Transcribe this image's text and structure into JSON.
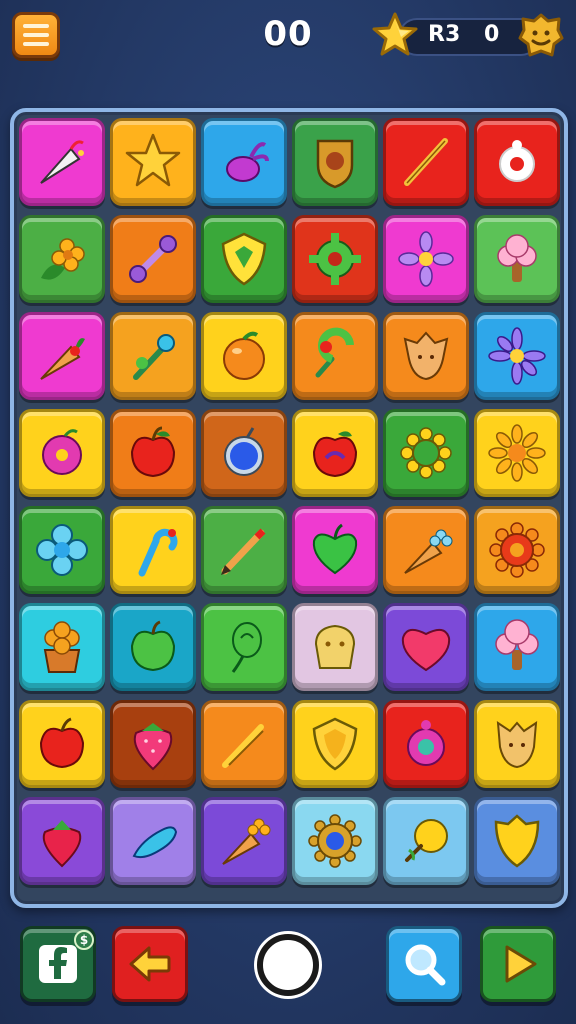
{
  "header": {
    "menu_icon": "hamburger-menu-icon",
    "score": "00",
    "star_icon": "gold-star-icon",
    "counter_label": "R3",
    "counter_value": "0",
    "badge_icon": "gold-face-badge-icon"
  },
  "board": {
    "columns": 6,
    "rows": [
      [
        {
          "name": "party-popper",
          "bg": "#ef3ad0",
          "icon": "party-popper-icon"
        },
        {
          "name": "star",
          "bg": "#ffb21c",
          "icon": "star-icon"
        },
        {
          "name": "radish",
          "bg": "#2ea7ea",
          "icon": "radish-icon"
        },
        {
          "name": "crest",
          "bg": "#3aa24a",
          "icon": "crest-icon"
        },
        {
          "name": "stick",
          "bg": "#e8231d",
          "icon": "stick-icon"
        },
        {
          "name": "ring",
          "bg": "#e8231d",
          "icon": "ring-icon"
        }
      ],
      [
        {
          "name": "flower-leaf",
          "bg": "#4caf45",
          "icon": "flower-leaf-icon"
        },
        {
          "name": "dumbbell",
          "bg": "#f07d18",
          "icon": "dumbbell-icon"
        },
        {
          "name": "shield",
          "bg": "#3aa83a",
          "icon": "shield-icon"
        },
        {
          "name": "gear",
          "bg": "#e0341b",
          "icon": "gear-icon"
        },
        {
          "name": "purple-flower",
          "bg": "#ef3ad0",
          "icon": "purple-flower-icon"
        },
        {
          "name": "mushroom-tree",
          "bg": "#5cc257",
          "icon": "mushroom-tree-icon"
        }
      ],
      [
        {
          "name": "carrot",
          "bg": "#ef3ad0",
          "icon": "carrot-icon"
        },
        {
          "name": "pinwheel",
          "bg": "#f5a21f",
          "icon": "pinwheel-icon"
        },
        {
          "name": "orange",
          "bg": "#ffd21c",
          "icon": "orange-icon"
        },
        {
          "name": "lollipop",
          "bg": "#f58a1c",
          "icon": "lollipop-icon"
        },
        {
          "name": "leaf-face",
          "bg": "#f58a1c",
          "icon": "leaf-face-icon"
        },
        {
          "name": "blue-flower",
          "bg": "#2ea7ea",
          "icon": "blue-flower-icon"
        }
      ],
      [
        {
          "name": "donut",
          "bg": "#ffd21c",
          "icon": "donut-icon"
        },
        {
          "name": "red-apple",
          "bg": "#f07d18",
          "icon": "red-apple-icon"
        },
        {
          "name": "blue-orb",
          "bg": "#d0661a",
          "icon": "blue-orb-icon"
        },
        {
          "name": "apple-swirl",
          "bg": "#ffd21c",
          "icon": "apple-swirl-icon"
        },
        {
          "name": "sunflower",
          "bg": "#3aa83a",
          "icon": "sunflower-icon"
        },
        {
          "name": "sun-flower",
          "bg": "#ffd21c",
          "icon": "sun-flower-icon"
        }
      ],
      [
        {
          "name": "cyan-flower",
          "bg": "#3aa83a",
          "icon": "cyan-flower-icon"
        },
        {
          "name": "candy-cane",
          "bg": "#ffd21c",
          "icon": "candy-cane-icon"
        },
        {
          "name": "pencil",
          "bg": "#4caf45",
          "icon": "pencil-icon"
        },
        {
          "name": "green-heart",
          "bg": "#ef3ad0",
          "icon": "green-heart-icon"
        },
        {
          "name": "carrot-flower",
          "bg": "#f58a1c",
          "icon": "carrot-flower-icon"
        },
        {
          "name": "red-gear",
          "bg": "#f5a21f",
          "icon": "red-gear-icon"
        }
      ],
      [
        {
          "name": "orange-flower",
          "bg": "#2ecde0",
          "icon": "orange-flower-icon"
        },
        {
          "name": "green-apple",
          "bg": "#1aa6c8",
          "icon": "green-apple-icon"
        },
        {
          "name": "balloon",
          "bg": "#4cc244",
          "icon": "balloon-icon"
        },
        {
          "name": "cookie",
          "bg": "#e2c6e2",
          "icon": "cookie-icon"
        },
        {
          "name": "heart",
          "bg": "#7c4ad8",
          "icon": "heart-icon"
        },
        {
          "name": "pink-tree",
          "bg": "#2ea7ea",
          "icon": "pink-tree-icon"
        }
      ],
      [
        {
          "name": "apple",
          "bg": "#ffd21c",
          "icon": "apple-icon"
        },
        {
          "name": "strawberry",
          "bg": "#a8400f",
          "icon": "strawberry-icon"
        },
        {
          "name": "wand",
          "bg": "#f58a1c",
          "icon": "wand-icon"
        },
        {
          "name": "gold-shield",
          "bg": "#ffd21c",
          "icon": "gold-shield-icon"
        },
        {
          "name": "pink-ring",
          "bg": "#e8231d",
          "icon": "pink-ring-icon"
        },
        {
          "name": "fox-face",
          "bg": "#ffd21c",
          "icon": "fox-face-icon"
        }
      ],
      [
        {
          "name": "berry",
          "bg": "#8a4ad8",
          "icon": "berry-icon"
        },
        {
          "name": "blue-pepper",
          "bg": "#a080e8",
          "icon": "blue-pepper-icon"
        },
        {
          "name": "carrot-bloom",
          "bg": "#7c4ad8",
          "icon": "carrot-bloom-icon"
        },
        {
          "name": "medallion",
          "bg": "#8ad8f0",
          "icon": "medallion-icon"
        },
        {
          "name": "yellow-lollipop",
          "bg": "#7cc8f0",
          "icon": "yellow-lollipop-icon"
        },
        {
          "name": "yellow-shield",
          "bg": "#5a8ee0",
          "icon": "yellow-shield-icon"
        }
      ]
    ]
  },
  "footer": {
    "facebook_button_icon": "facebook-icon",
    "facebook_badge": "$",
    "back_button_icon": "back-arrow-icon",
    "center_button_icon": "circle-icon",
    "search_button_icon": "magnifier-icon",
    "play_button_icon": "play-icon"
  },
  "colors": {
    "background": "#243a66",
    "board_border": "#8fb6e6",
    "menu_button": "#f59a1f",
    "facebook_button": "#1f6b40",
    "back_button": "#e02020",
    "search_button": "#2ea7ea",
    "play_button": "#2f9b3a"
  }
}
